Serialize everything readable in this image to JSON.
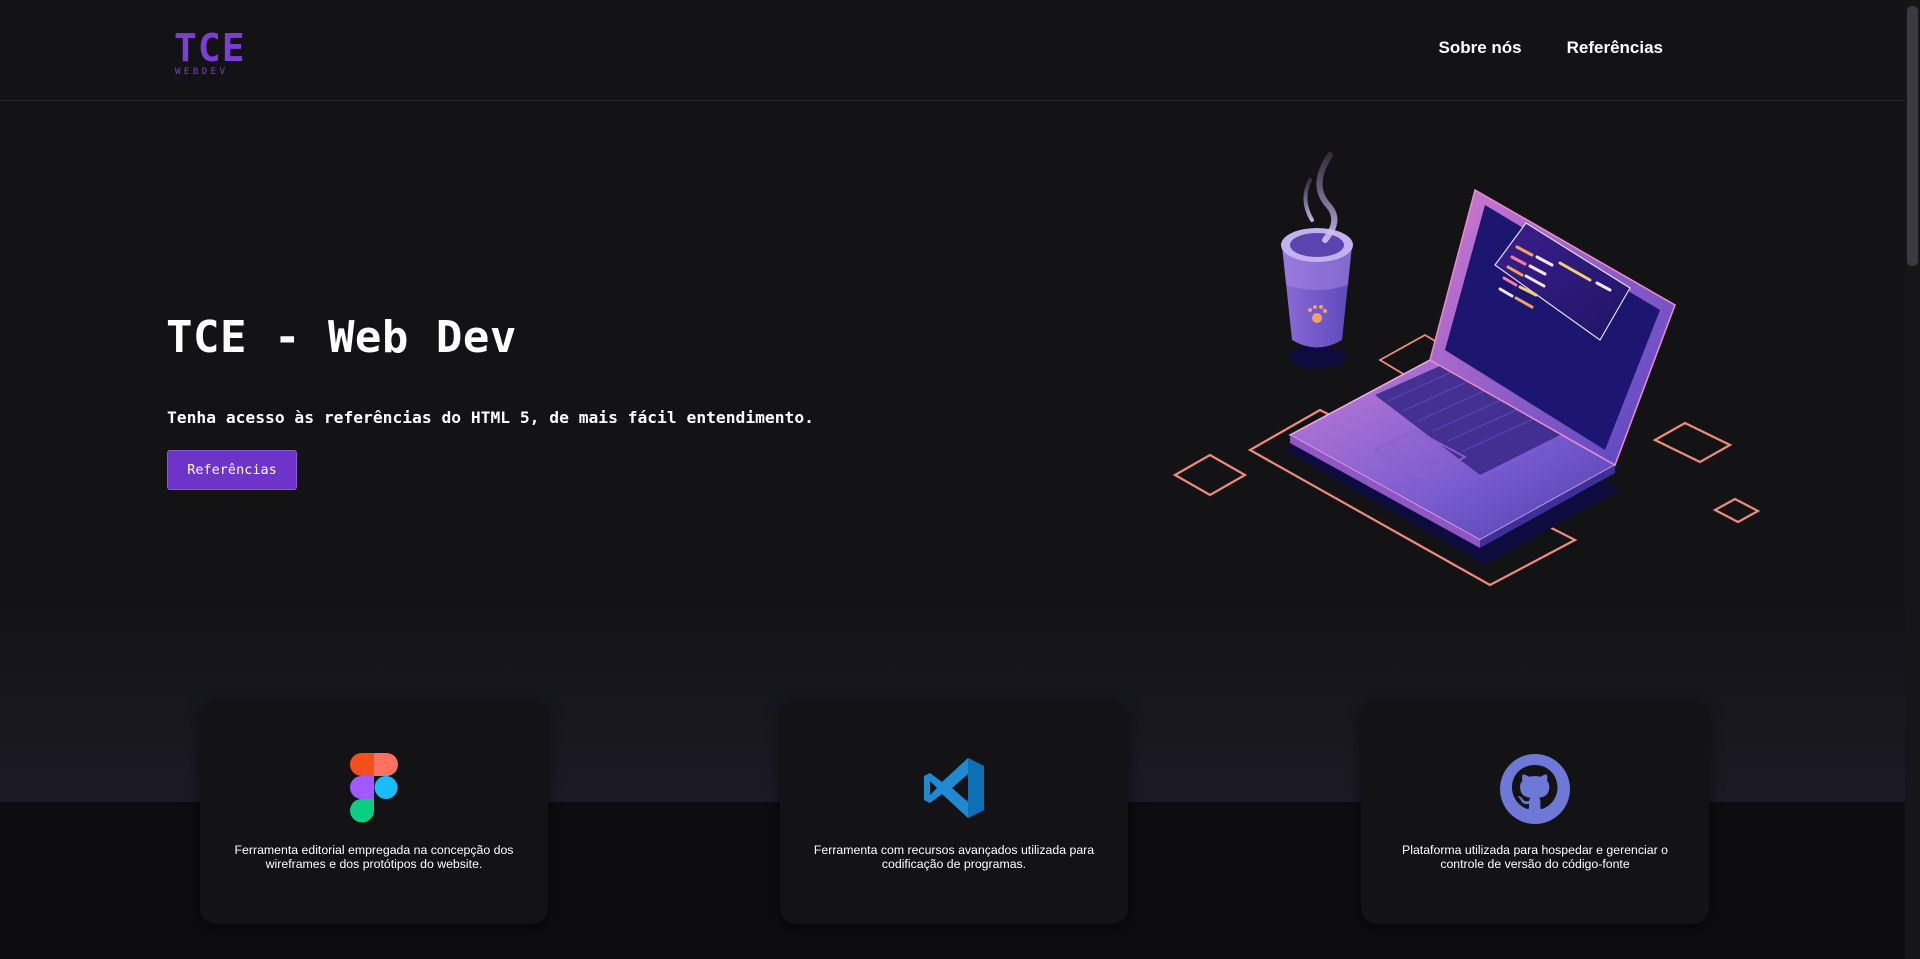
{
  "header": {
    "logo_main": "TCE",
    "logo_sub": "WEBDEV",
    "nav": [
      "Sobre nós",
      "Referências"
    ]
  },
  "hero": {
    "title": "TCE - Web Dev",
    "subtitle": "Tenha acesso às referências do HTML 5, de mais fácil entendimento.",
    "button_label": "Referências"
  },
  "cards": [
    {
      "icon": "figma-icon",
      "text": "Ferramenta editorial empregada na concepção dos wireframes e dos protótipos do website."
    },
    {
      "icon": "vscode-icon",
      "text": "Ferramenta com recursos avançados utilizada para codificação de programas."
    },
    {
      "icon": "github-icon",
      "text": "Plataforma utilizada para hospedar e gerenciar o controle de versão do código-fonte"
    }
  ],
  "colors": {
    "background": "#131316",
    "accent": "#6e34c9",
    "logo": "#7b3fd4",
    "text": "#ffffff"
  }
}
